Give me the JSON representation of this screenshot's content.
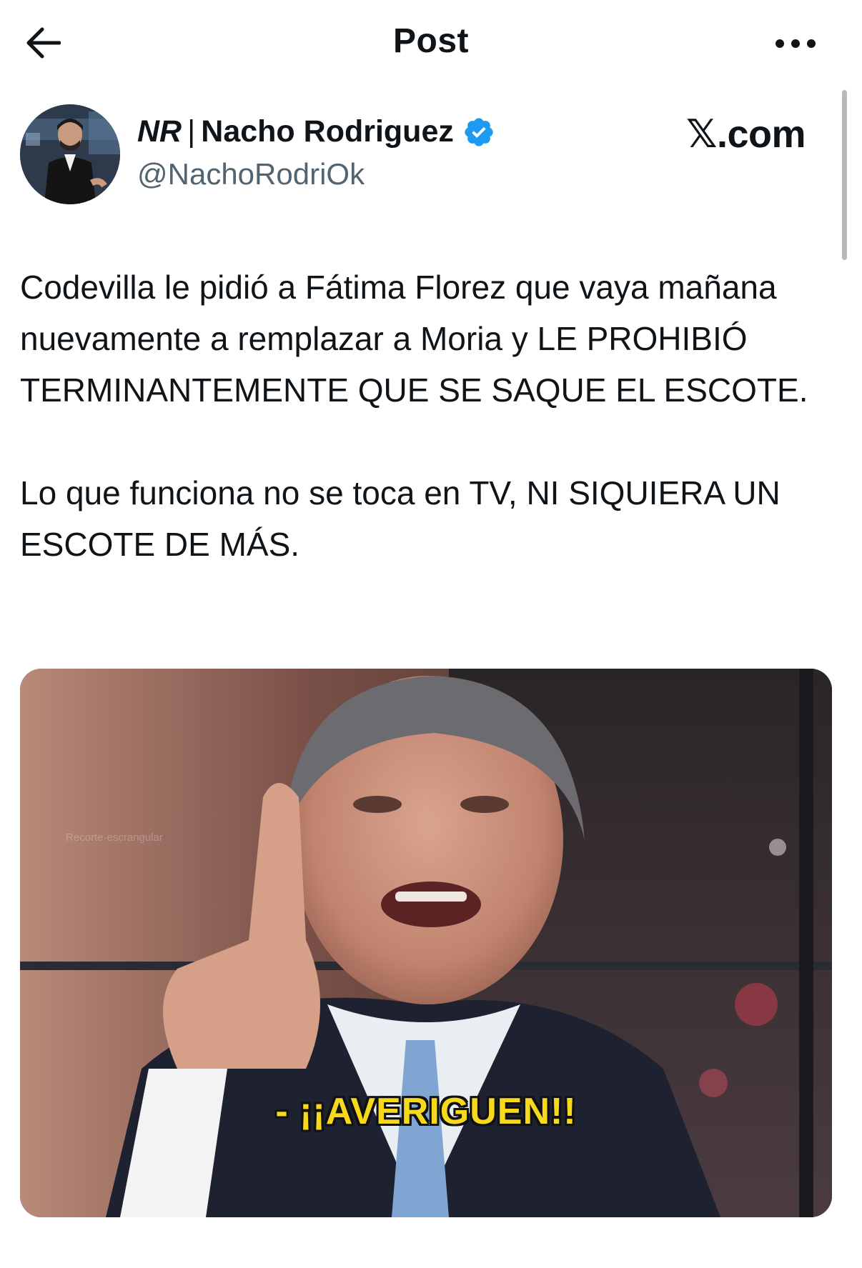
{
  "header": {
    "title": "Post",
    "back_icon": "arrow-left-icon",
    "more_icon": "more-horizontal-icon"
  },
  "author": {
    "name_prefix": "NR",
    "name_separator": "|",
    "name": "Nacho Rodriguez",
    "handle": "@NachoRodriOk",
    "verified_color": "#1d9bf0"
  },
  "source_watermark": "𝕏.com",
  "tweet": {
    "paragraphs": [
      "Codevilla le pidió a Fátima Florez que vaya mañana nuevamente a remplazar a Moria y LE PROHIBIÓ TERMINANTEMENTE QUE SE SAQUE EL ESCOTE.",
      "Lo que funciona no se toca en TV, NI SIQUIERA UN ESCOTE DE MÁS."
    ]
  },
  "media": {
    "subtitle": "- ¡¡AVERIGUEN!!",
    "watermark_text": "Recorte·escrangular",
    "subtitle_color": "#f6d91c"
  },
  "colors": {
    "text": "#0f1419",
    "secondary": "#536471",
    "verified": "#1d9bf0"
  }
}
